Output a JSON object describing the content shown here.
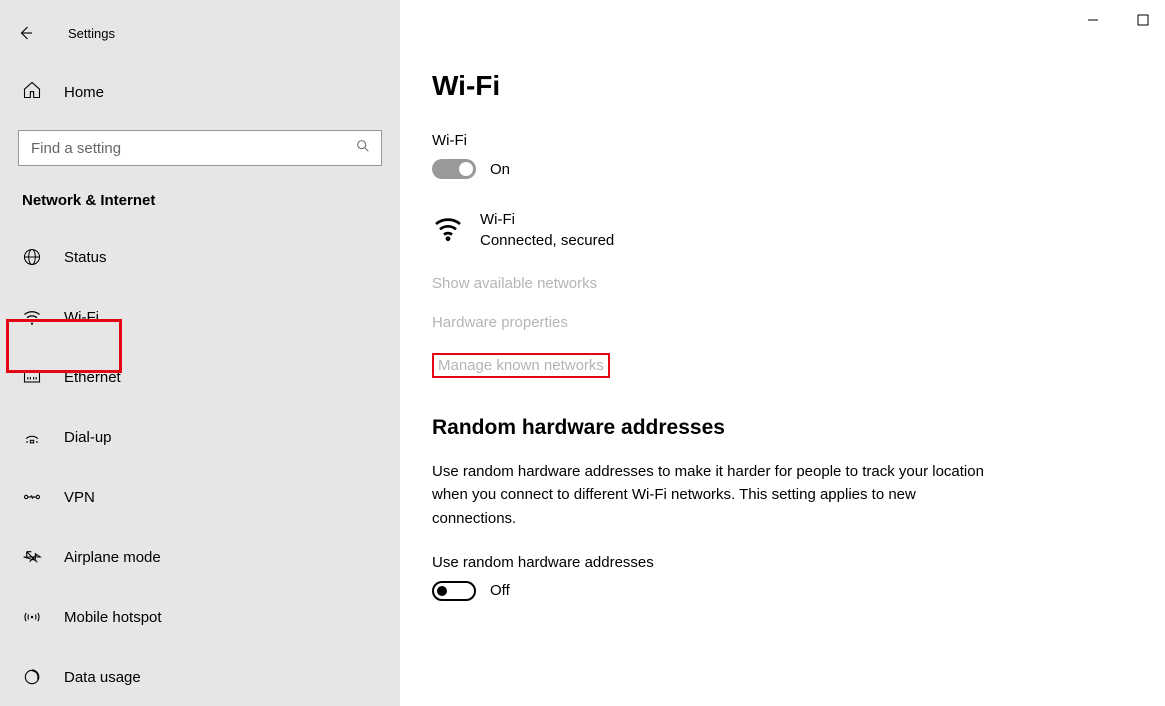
{
  "app": {
    "title": "Settings"
  },
  "sidebar": {
    "home": "Home",
    "search_placeholder": "Find a setting",
    "category": "Network & Internet",
    "items": [
      {
        "label": "Status"
      },
      {
        "label": "Wi-Fi"
      },
      {
        "label": "Ethernet"
      },
      {
        "label": "Dial-up"
      },
      {
        "label": "VPN"
      },
      {
        "label": "Airplane mode"
      },
      {
        "label": "Mobile hotspot"
      },
      {
        "label": "Data usage"
      }
    ]
  },
  "page": {
    "title": "Wi-Fi",
    "wifi_label": "Wi-Fi",
    "wifi_toggle_state": "On",
    "connection": {
      "name": "Wi-Fi",
      "status": "Connected, secured"
    },
    "links": {
      "show_networks": "Show available networks",
      "hardware_props": "Hardware properties",
      "manage_known": "Manage known networks"
    },
    "random": {
      "title": "Random hardware addresses",
      "description": "Use random hardware addresses to make it harder for people to track your location when you connect to different Wi-Fi networks. This setting applies to new connections.",
      "toggle_label": "Use random hardware addresses",
      "toggle_state": "Off"
    }
  }
}
